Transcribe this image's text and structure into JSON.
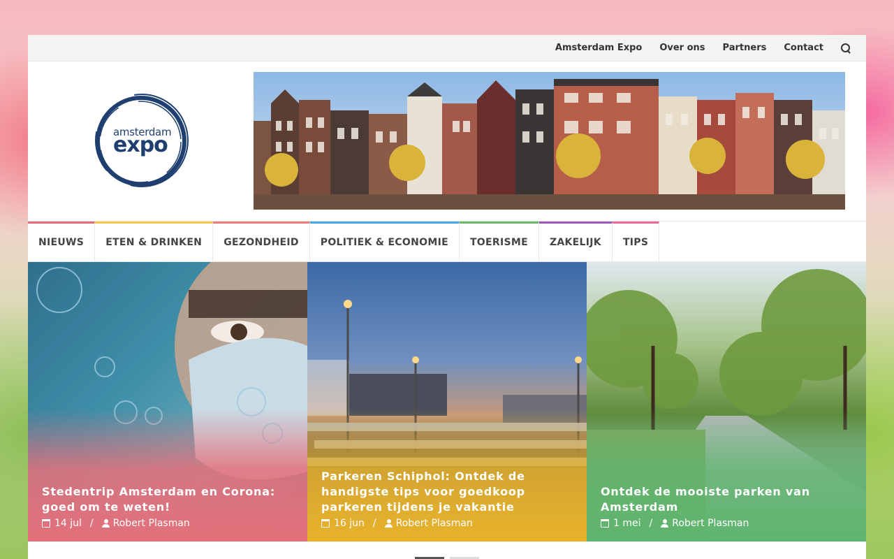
{
  "topnav": {
    "links": [
      "Amsterdam Expo",
      "Over ons",
      "Partners",
      "Contact"
    ],
    "search_icon": "search-icon"
  },
  "logo": {
    "line1": "amsterdam",
    "line2": "expo",
    "color": "#1f3f70"
  },
  "nav": {
    "items": [
      {
        "label": "NIEUWS",
        "color": "#e06c78"
      },
      {
        "label": "ETEN & DRINKEN",
        "color": "#f2c94c"
      },
      {
        "label": "GEZONDHEID",
        "color": "#e87c7c"
      },
      {
        "label": "POLITIEK & ECONOMIE",
        "color": "#45a7e8"
      },
      {
        "label": "TOERISME",
        "color": "#6dbb6a"
      },
      {
        "label": "ZAKELIJK",
        "color": "#9b59b6"
      },
      {
        "label": "TIPS",
        "color": "#e8699a"
      }
    ]
  },
  "features": [
    {
      "title": "Stedentrip Amsterdam en Corona: goed om te weten!",
      "date": "14 jul",
      "author": "Robert Plasman",
      "accent": "#e4707a"
    },
    {
      "title": "Parkeren Schiphol: Ontdek de handigste tips voor goedkoop parkeren tijdens je vakantie",
      "date": "16 jun",
      "author": "Robert Plasman",
      "accent": "#e8b22a"
    },
    {
      "title": "Ontdek de mooiste parken van Amsterdam",
      "date": "1 mei",
      "author": "Robert Plasman",
      "accent": "#5fb56f"
    }
  ],
  "meta_separator": "/"
}
